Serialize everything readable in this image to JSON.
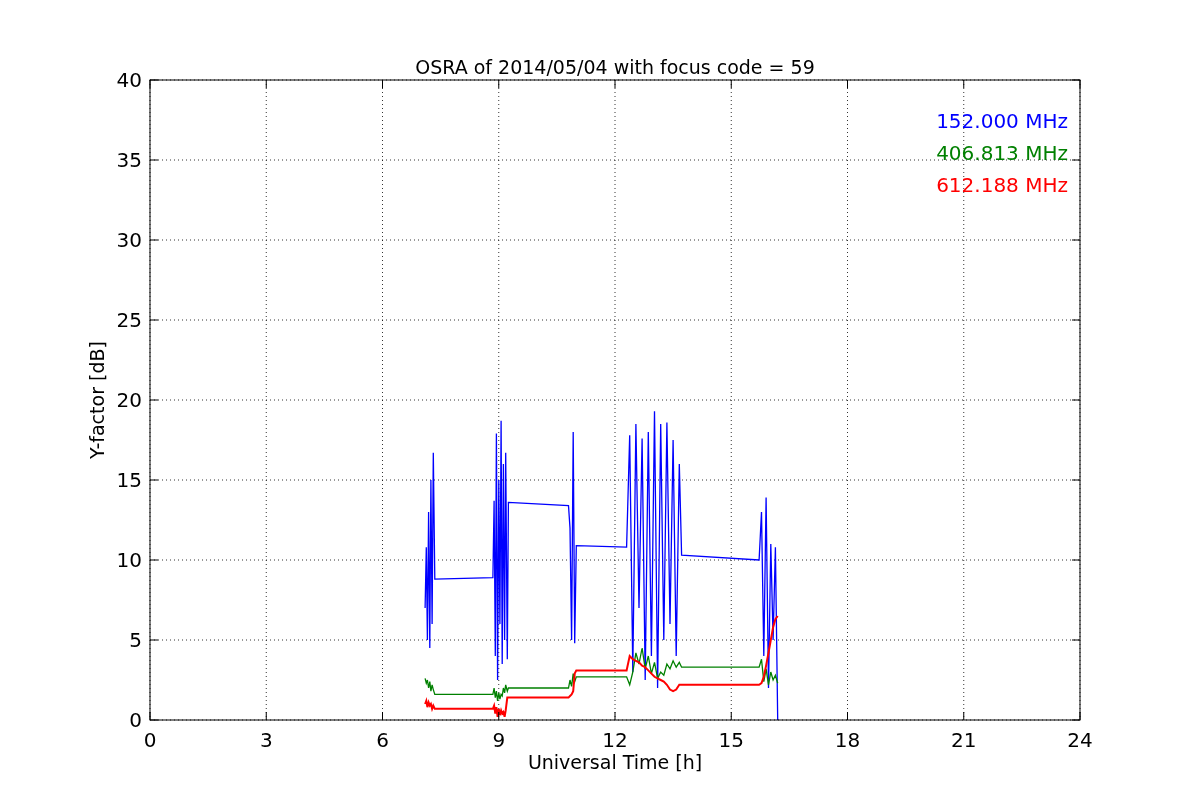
{
  "chart": {
    "chart_data": {
      "type": "line",
      "title": "OSRA of 2014/05/04 with focus code = 59",
      "xlabel": "Universal Time [h]",
      "ylabel": "Y-factor [dB]",
      "grid": true,
      "xlim": [
        0,
        24
      ],
      "ylim": [
        0,
        40
      ],
      "xticks": [
        0,
        3,
        6,
        9,
        12,
        15,
        18,
        21,
        24
      ],
      "yticks": [
        0,
        5,
        10,
        15,
        20,
        25,
        30,
        35,
        40
      ],
      "x": [
        7.1,
        7.13,
        7.16,
        7.19,
        7.22,
        7.25,
        7.28,
        7.31,
        7.35,
        8.85,
        8.88,
        8.91,
        8.94,
        8.97,
        9.0,
        9.03,
        9.06,
        9.09,
        9.12,
        9.15,
        9.18,
        9.22,
        9.25,
        10.8,
        10.84,
        10.88,
        10.92,
        10.96,
        11.0,
        12.3,
        12.38,
        12.46,
        12.54,
        12.62,
        12.7,
        12.78,
        12.86,
        12.94,
        13.02,
        13.1,
        13.18,
        13.26,
        13.34,
        13.42,
        13.5,
        13.58,
        13.66,
        13.72,
        15.72,
        15.78,
        15.84,
        15.9,
        15.96,
        16.02,
        16.08,
        16.14,
        16.2
      ],
      "series": [
        {
          "name": "152.000 MHz",
          "color": "#0000ff",
          "values": [
            7,
            10.8,
            5,
            13,
            4.5,
            15,
            6,
            16.7,
            8.8,
            8.9,
            13.7,
            4,
            17.9,
            2.5,
            15,
            6,
            18.7,
            3.5,
            16,
            5,
            16.7,
            3.8,
            13.6,
            13.4,
            12,
            5,
            18,
            4.8,
            10.9,
            10.8,
            17.8,
            3,
            18.5,
            7,
            17.6,
            2.5,
            18,
            4,
            19.3,
            2,
            18.5,
            5,
            18.6,
            6,
            17.5,
            4,
            16,
            10.3,
            10.0,
            13,
            4,
            13.9,
            2,
            11,
            5,
            10.8,
            0
          ]
        },
        {
          "name": "406.813 MHz",
          "color": "#008000",
          "values": [
            2.6,
            2.3,
            2.5,
            2.0,
            2.4,
            1.8,
            2.2,
            1.9,
            1.6,
            1.6,
            2.0,
            1.4,
            1.8,
            1.2,
            1.7,
            1.3,
            1.6,
            1.5,
            2.0,
            1.7,
            2.2,
            1.8,
            2.0,
            2.0,
            2.5,
            2.1,
            2.9,
            2.4,
            2.7,
            2.7,
            2.2,
            3.0,
            4.2,
            3.5,
            4.5,
            3.2,
            4.0,
            2.9,
            3.6,
            2.6,
            3.0,
            2.8,
            3.5,
            3.2,
            3.7,
            3.3,
            3.6,
            3.3,
            3.3,
            3.8,
            2.4,
            3.2,
            2.2,
            3.0,
            2.5,
            2.8,
            2.3
          ]
        },
        {
          "name": "612.188 MHz",
          "color": "#ff0000",
          "values": [
            1.0,
            1.2,
            0.8,
            1.1,
            0.9,
            1.0,
            0.7,
            0.9,
            0.7,
            0.7,
            0.9,
            0.4,
            0.8,
            0.2,
            0.7,
            0.3,
            0.6,
            0.4,
            0.5,
            0.2,
            0.6,
            1.4,
            1.4,
            1.4,
            1.5,
            1.6,
            1.8,
            2.9,
            3.1,
            3.1,
            4.0,
            3.8,
            3.7,
            3.6,
            3.4,
            3.3,
            3.1,
            2.9,
            2.7,
            2.6,
            2.5,
            2.4,
            2.2,
            1.9,
            1.8,
            1.9,
            2.2,
            2.2,
            2.2,
            2.3,
            2.7,
            3.4,
            4.2,
            5.0,
            5.8,
            6.3,
            6.5
          ]
        }
      ]
    }
  }
}
